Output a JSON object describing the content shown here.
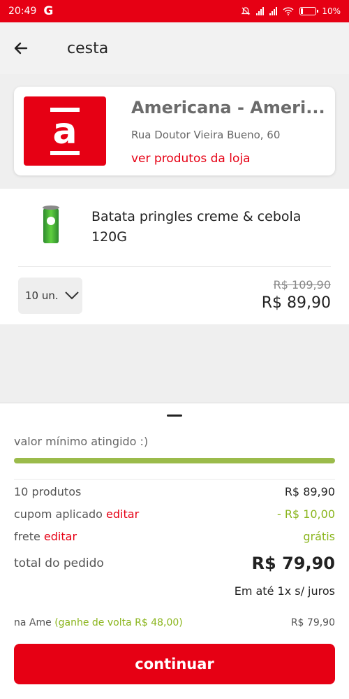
{
  "status_bar": {
    "time": "20:49",
    "carrier_glyph": "G",
    "battery": "10%"
  },
  "header": {
    "title": "cesta"
  },
  "store": {
    "logo_letter": "a",
    "name": "Americana  - Ameri...",
    "address": "Rua Doutor Vieira Bueno, 60",
    "link": "ver produtos da loja"
  },
  "cart_item": {
    "name": "Batata pringles creme & cebola 120G",
    "quantity": "10 un.",
    "old_price": "R$ 109,90",
    "price": "R$ 89,90"
  },
  "summary": {
    "min_reached": "valor mínimo atingido :)",
    "progress_fraction": 1.0,
    "products_label": "10 produtos",
    "products_value": "R$ 89,90",
    "coupon_label": "cupom aplicado",
    "coupon_edit": "editar",
    "coupon_value": "- R$ 10,00",
    "shipping_label": "frete",
    "shipping_edit": "editar",
    "shipping_value": "grátis",
    "total_label": "total do pedido",
    "total_value": "R$ 79,90",
    "installments": "Em até 1x s/ juros",
    "ame_label": "na Ame",
    "ame_cashback": "(ganhe de volta R$ 48,00)",
    "ame_value": "R$ 79,90"
  },
  "cta": {
    "label": "continuar"
  },
  "colors": {
    "brand_red": "#e60014",
    "progress_green": "#9bbb4b",
    "accent_green": "#8ab51c"
  }
}
